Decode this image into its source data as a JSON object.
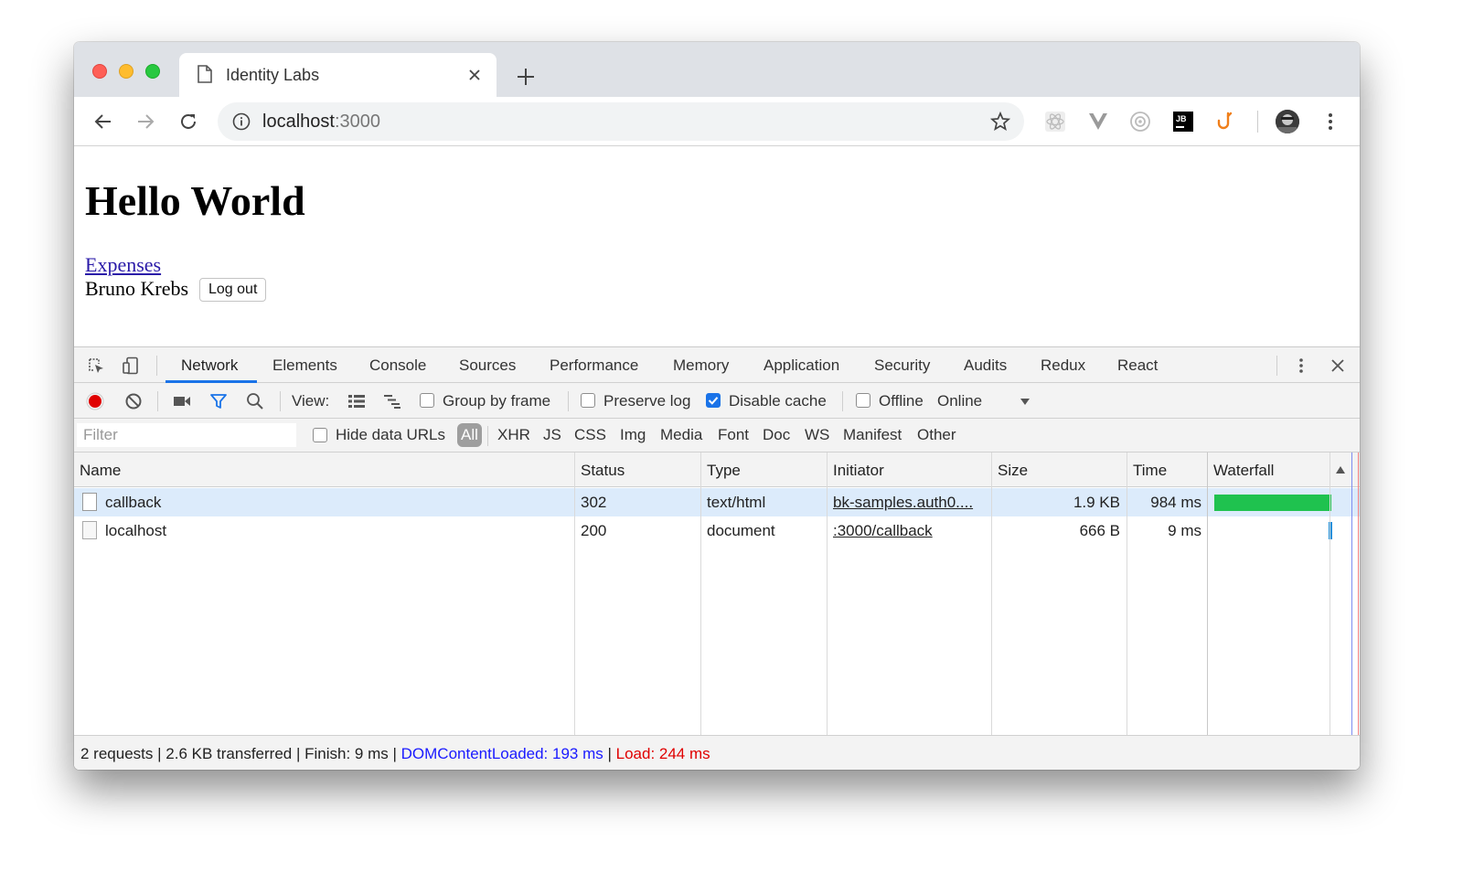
{
  "browser": {
    "tab_title": "Identity Labs",
    "url_host": "localhost",
    "url_port": ":3000",
    "extensions": [
      "react-devtools-icon",
      "vue-devtools-icon",
      "extension-circle-icon",
      "jetbrains-icon",
      "hook-icon"
    ]
  },
  "page": {
    "heading": "Hello World",
    "link": "Expenses",
    "user_name": "Bruno Krebs",
    "logout_label": "Log out"
  },
  "devtools": {
    "tabs": [
      "Network",
      "Elements",
      "Console",
      "Sources",
      "Performance",
      "Memory",
      "Application",
      "Security",
      "Audits",
      "Redux",
      "React"
    ],
    "active_tab": "Network",
    "toolbar": {
      "view_label": "View:",
      "group_by_frame": "Group by frame",
      "preserve_log": "Preserve log",
      "disable_cache": "Disable cache",
      "disable_cache_checked": true,
      "offline": "Offline",
      "throttling": "Online"
    },
    "filter": {
      "placeholder": "Filter",
      "hide_data_urls": "Hide data URLs",
      "types": [
        "All",
        "XHR",
        "JS",
        "CSS",
        "Img",
        "Media",
        "Font",
        "Doc",
        "WS",
        "Manifest",
        "Other"
      ],
      "active_type": "All"
    },
    "columns": [
      "Name",
      "Status",
      "Type",
      "Initiator",
      "Size",
      "Time",
      "Waterfall"
    ],
    "rows": [
      {
        "name": "callback",
        "status": "302",
        "type": "text/html",
        "initiator": "bk-samples.auth0....",
        "size": "1.9 KB",
        "time": "984 ms"
      },
      {
        "name": "localhost",
        "status": "200",
        "type": "document",
        "initiator": ":3000/callback",
        "size": "666 B",
        "time": "9 ms"
      }
    ],
    "summary": {
      "requests": "2 requests",
      "transferred": "2.6 KB transferred",
      "finish": "Finish: 9 ms",
      "dom_content_loaded": "DOMContentLoaded: 193 ms",
      "load": "Load: 244 ms",
      "separator": " | "
    },
    "colors": {
      "accent": "#1a73e8",
      "dom_content_loaded": "#1a1aff",
      "load": "#e00000",
      "waterfall_green": "#1fc24f",
      "waterfall_blue": "#1a8fdb",
      "record_red": "#e00000"
    }
  }
}
